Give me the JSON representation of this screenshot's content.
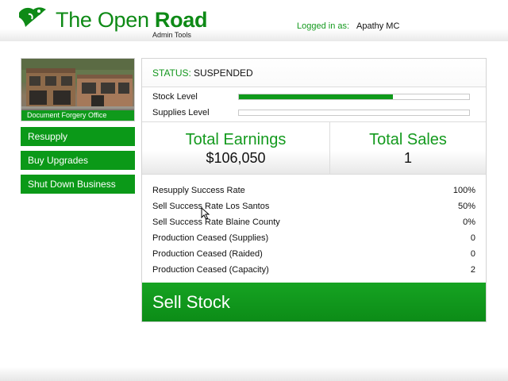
{
  "header": {
    "brand_title_regular": "The Open ",
    "brand_title_bold": "Road",
    "brand_subtitle": "Admin Tools",
    "login_label": "Logged in as:",
    "login_user": "Apathy MC"
  },
  "business": {
    "caption": "Document Forgery Office"
  },
  "sidebar": {
    "buttons": [
      {
        "label": "Resupply"
      },
      {
        "label": "Buy Upgrades"
      },
      {
        "label": "Shut Down Business"
      }
    ]
  },
  "status": {
    "label": "STATUS:",
    "value": "SUSPENDED"
  },
  "levels": [
    {
      "label": "Stock Level",
      "fraction": 0.67
    },
    {
      "label": "Supplies Level",
      "fraction": 0.0
    }
  ],
  "totals": {
    "earnings_label": "Total Earnings",
    "earnings_value": "$106,050",
    "sales_label": "Total Sales",
    "sales_value": "1"
  },
  "stats": [
    {
      "label": "Resupply Success Rate",
      "value": "100%"
    },
    {
      "label": "Sell Success Rate Los Santos",
      "value": "50%"
    },
    {
      "label": "Sell Success Rate Blaine County",
      "value": "0%"
    },
    {
      "label": "Production Ceased (Supplies)",
      "value": "0"
    },
    {
      "label": "Production Ceased (Raided)",
      "value": "0"
    },
    {
      "label": "Production Ceased (Capacity)",
      "value": "2"
    }
  ],
  "sell_button": {
    "label": "Sell Stock"
  },
  "colors": {
    "brand_green": "#0e8a16",
    "button_green": "#0b9918",
    "background": "#ececec"
  }
}
